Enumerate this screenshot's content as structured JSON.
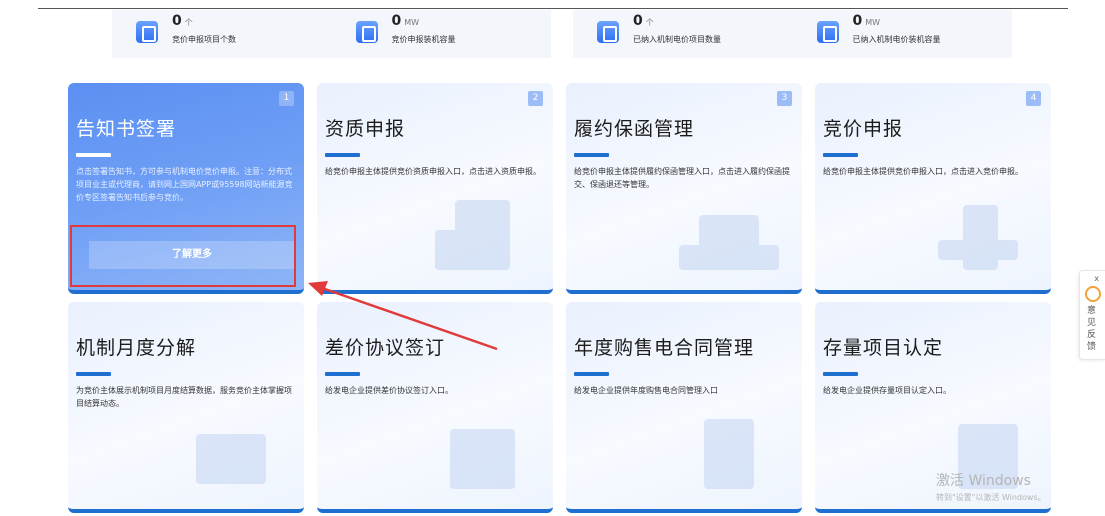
{
  "stats": [
    {
      "value": "0",
      "unit": "个",
      "label": "竞价申报项目个数"
    },
    {
      "value": "0",
      "unit": "MW",
      "label": "竞价申报装机容量"
    },
    {
      "value": "0",
      "unit": "个",
      "label": "已纳入机制电价项目数量"
    },
    {
      "value": "0",
      "unit": "MW",
      "label": "已纳入机制电价装机容量"
    }
  ],
  "cards": [
    {
      "num": "1",
      "title": "告知书签署",
      "desc": "点击签署告知书，方可参与机制电价竞价申报。注意：分布式项目业主或代理商，请到网上国网APP或95598网站新能源竞价专区签署告知书后参与竞价。",
      "button": "了解更多"
    },
    {
      "num": "2",
      "title": "资质申报",
      "desc": "给竞价申报主体提供竞价资质申报入口，点击进入资质申报。"
    },
    {
      "num": "3",
      "title": "履约保函管理",
      "desc": "给竞价申报主体提供履约保函管理入口，点击进入履约保函提交、保函退还等管理。"
    },
    {
      "num": "4",
      "title": "竞价申报",
      "desc": "给竞价申报主体提供竞价申报入口，点击进入竞价申报。"
    },
    {
      "num": "",
      "title": "机制月度分解",
      "desc": "为竞价主体展示机制项目月度结算数据，服务竞价主体掌握项目结算动态。"
    },
    {
      "num": "",
      "title": "差价协议签订",
      "desc": "给发电企业提供差价协议签订入口。"
    },
    {
      "num": "",
      "title": "年度购售电合同管理",
      "desc": "给发电企业提供年度购售电合同管理入口"
    },
    {
      "num": "",
      "title": "存量项目认定",
      "desc": "给发电企业提供存量项目认定入口。"
    }
  ],
  "feedback": {
    "close": "x",
    "label": "意见反馈"
  },
  "watermark": {
    "title": "激活 Windows",
    "subtitle": "转到\"设置\"以激活 Windows。"
  },
  "colors": {
    "accent": "#1f6fd1",
    "active_card": "#5b8ff2",
    "highlight": "#e03a3a"
  }
}
